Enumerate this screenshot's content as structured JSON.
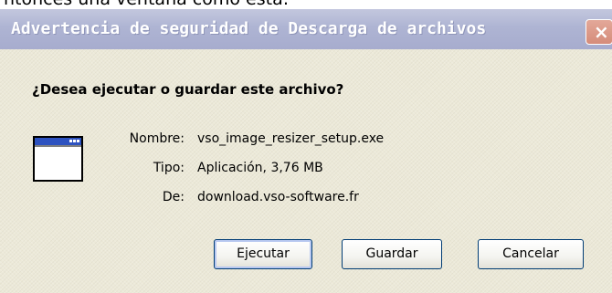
{
  "caption": "ntonces una ventana como ésta:",
  "dialog": {
    "title": "Advertencia de seguridad de Descarga de archivos",
    "close_label": "×",
    "question": "¿Desea ejecutar o guardar este archivo?",
    "icon": "application-window-icon",
    "fields": {
      "name_label": "Nombre:",
      "name_value": "vso_image_resizer_setup.exe",
      "type_label": "Tipo:",
      "type_value": "Aplicación, 3,76 MB",
      "from_label": "De:",
      "from_value": "download.vso-software.fr"
    },
    "buttons": {
      "run": "Ejecutar",
      "save": "Guardar",
      "cancel": "Cancelar"
    }
  },
  "colors": {
    "titlebar": "#aeb4d3",
    "dialog_bg": "#ece9d8",
    "close": "#d58c7a"
  }
}
